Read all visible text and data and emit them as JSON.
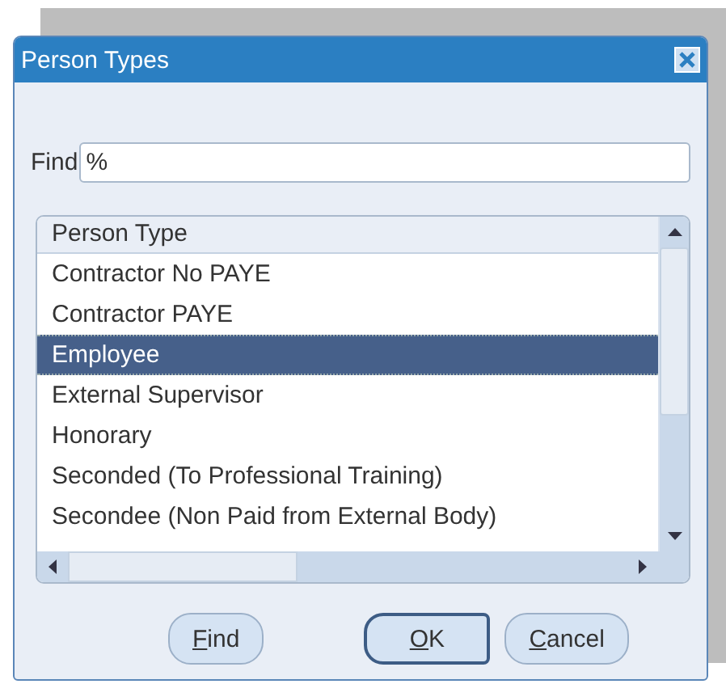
{
  "window": {
    "title": "Person Types"
  },
  "find": {
    "label": "Find",
    "value": "%"
  },
  "list": {
    "column": "Person Type",
    "rows": [
      {
        "label": "Contractor No PAYE",
        "selected": false
      },
      {
        "label": "Contractor PAYE",
        "selected": false
      },
      {
        "label": "Employee",
        "selected": true
      },
      {
        "label": "External Supervisor",
        "selected": false
      },
      {
        "label": "Honorary",
        "selected": false
      },
      {
        "label": "Seconded (To Professional Training)",
        "selected": false
      },
      {
        "label": "Secondee (Non Paid from External Body)",
        "selected": false
      }
    ]
  },
  "buttons": [
    {
      "label": "Find",
      "first_letter_underlined": true,
      "default": false
    },
    {
      "label": "OK",
      "first_letter_underlined": true,
      "default": true
    },
    {
      "label": "Cancel",
      "first_letter_underlined": true,
      "default": false
    }
  ]
}
